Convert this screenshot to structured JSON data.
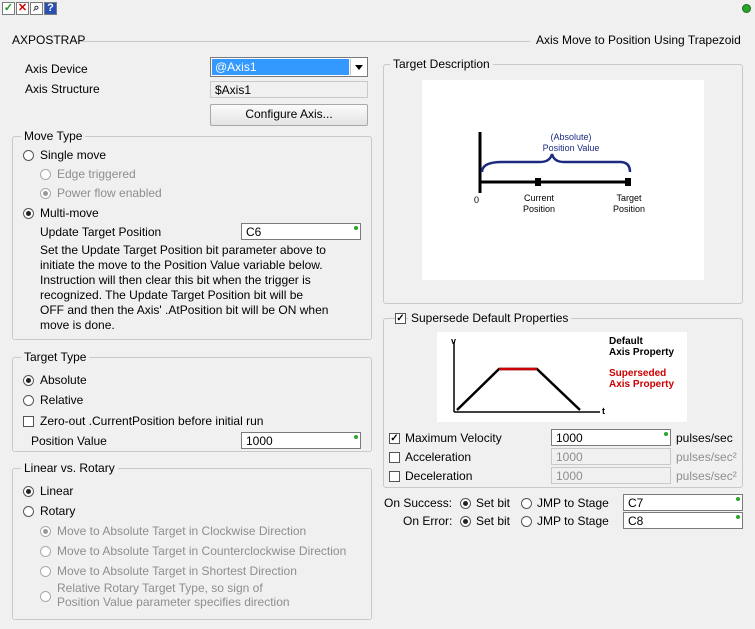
{
  "toolbar": {
    "accept_symbol": "✓",
    "cancel_symbol": "✕",
    "find_symbol": "⌕",
    "help_symbol": "?",
    "status_color": "#2aa52a"
  },
  "header": {
    "instruction_name": "AXPOSTRAP",
    "instruction_desc": "Axis Move to Position Using Trapezoid"
  },
  "axis": {
    "device_label": "Axis Device",
    "device_value": "@Axis1",
    "structure_label": "Axis Structure",
    "structure_value": "$Axis1",
    "configure_label": "Configure Axis..."
  },
  "move_type": {
    "title": "Move Type",
    "single_move": "Single move",
    "edge_triggered": "Edge triggered",
    "power_flow": "Power flow enabled",
    "multi_move": "Multi-move",
    "update_label": "Update Target Position",
    "update_value": "C6",
    "desc_lines": [
      "Set the Update Target Position bit parameter above to",
      "initiate the move to the Position Value variable below.",
      "Instruction will then clear this bit when the trigger is",
      "recognized.  The Update Target Position bit will be",
      "OFF and then the Axis' .AtPosition bit will be ON when",
      "move is done."
    ]
  },
  "target_type": {
    "title": "Target Type",
    "absolute": "Absolute",
    "relative": "Relative",
    "zero_out": "Zero-out .CurrentPosition before initial run",
    "position_label": "Position Value",
    "position_value": "1000"
  },
  "linear_rotary": {
    "title": "Linear vs. Rotary",
    "linear": "Linear",
    "rotary": "Rotary",
    "cw": "Move to Absolute Target in Clockwise Direction",
    "ccw": "Move to Absolute Target in Counterclockwise Direction",
    "shortest": "Move to Absolute Target in Shortest Direction",
    "relative_line1": "Relative Rotary Target Type, so sign of",
    "relative_line2": "Position Value parameter specifies direction"
  },
  "target_desc": {
    "title": "Target Description",
    "abs_line1": "(Absolute)",
    "abs_line2": "Position Value",
    "zero": "0",
    "current_line1": "Current",
    "current_line2": "Position",
    "target_line1": "Target",
    "target_line2": "Position"
  },
  "supersede": {
    "title": "Supersede Default Properties",
    "graph_v": "v",
    "graph_t": "t",
    "default_line1": "Default",
    "default_line2": "Axis Property",
    "superseded_line1": "Superseded",
    "superseded_line2": "Axis Property",
    "max_vel_label": "Maximum Velocity",
    "max_vel_value": "1000",
    "max_vel_unit": "pulses/sec",
    "accel_label": "Acceleration",
    "accel_value": "1000",
    "accel_unit": "pulses/sec²",
    "decel_label": "Deceleration",
    "decel_value": "1000",
    "decel_unit": "pulses/sec²"
  },
  "outcome": {
    "success_label": "On Success:",
    "error_label": "On Error:",
    "set_bit": "Set bit",
    "jmp": "JMP to Stage",
    "success_value": "C7",
    "error_value": "C8"
  },
  "colors": {
    "accent": "#3399ff",
    "navy": "#1c2a80",
    "red": "#cc0000"
  }
}
